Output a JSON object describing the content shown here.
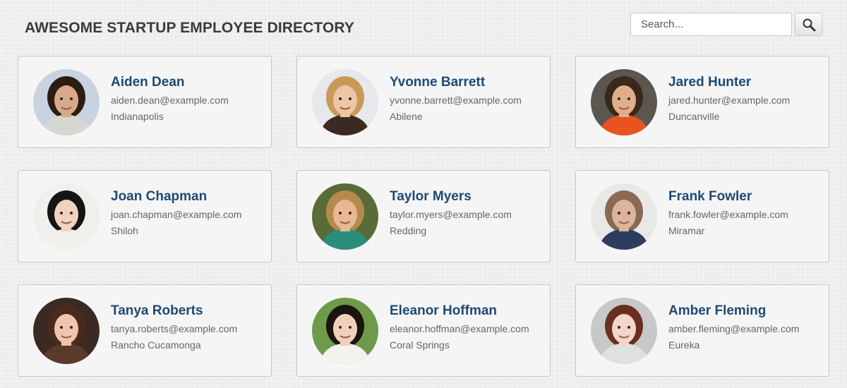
{
  "header": {
    "title": "AWESOME STARTUP EMPLOYEE DIRECTORY"
  },
  "search": {
    "placeholder": "Search...",
    "value": "",
    "button_icon": "search-icon"
  },
  "employees": [
    {
      "name": "Aiden Dean",
      "email": "aiden.dean@example.com",
      "city": "Indianapolis",
      "photo": {
        "bg": "#c9d2e0",
        "hair": "#2b1d14",
        "skin": "#d9a987",
        "shirt": "#d7d7d2"
      }
    },
    {
      "name": "Yvonne Barrett",
      "email": "yvonne.barrett@example.com",
      "city": "Abilene",
      "photo": {
        "bg": "#e6e8ec",
        "hair": "#c99a55",
        "skin": "#f0c5a6",
        "shirt": "#3a2a22"
      }
    },
    {
      "name": "Jared Hunter",
      "email": "jared.hunter@example.com",
      "city": "Duncanville",
      "photo": {
        "bg": "#5c5650",
        "hair": "#3a2818",
        "skin": "#e0ae8c",
        "shirt": "#e8531f"
      }
    },
    {
      "name": "Joan Chapman",
      "email": "joan.chapman@example.com",
      "city": "Shiloh",
      "photo": {
        "bg": "#eef0ec",
        "hair": "#151515",
        "skin": "#f1d2bd",
        "shirt": "#f2f0ea"
      }
    },
    {
      "name": "Taylor Myers",
      "email": "taylor.myers@example.com",
      "city": "Redding",
      "photo": {
        "bg": "#5a6b3a",
        "hair": "#b58a4e",
        "skin": "#e8b895",
        "shirt": "#2a8f7a"
      }
    },
    {
      "name": "Frank Fowler",
      "email": "frank.fowler@example.com",
      "city": "Miramar",
      "photo": {
        "bg": "#e8e8e6",
        "hair": "#8a6a52",
        "skin": "#dcb49a",
        "shirt": "#2d3d5e"
      }
    },
    {
      "name": "Tanya Roberts",
      "email": "tanya.roberts@example.com",
      "city": "Rancho Cucamonga",
      "photo": {
        "bg": "#3a2a22",
        "hair": "#4a2a1c",
        "skin": "#efc6ad",
        "shirt": "#5a3a2a"
      }
    },
    {
      "name": "Eleanor Hoffman",
      "email": "eleanor.hoffman@example.com",
      "city": "Coral Springs",
      "photo": {
        "bg": "#6f9a4a",
        "hair": "#1c1410",
        "skin": "#f0d2bb",
        "shirt": "#f4f2ee"
      }
    },
    {
      "name": "Amber Fleming",
      "email": "amber.fleming@example.com",
      "city": "Eureka",
      "photo": {
        "bg": "#c8c8c8",
        "hair": "#6a2e22",
        "skin": "#f2d6c8",
        "shirt": "#e0e0e0"
      }
    }
  ],
  "colors": {
    "name": "#1e4a73",
    "title": "#3b3b3b",
    "text": "#666666",
    "card_bg": "#f5f5f5",
    "card_border": "#c4c4c4"
  }
}
